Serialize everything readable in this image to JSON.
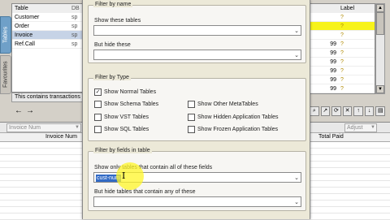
{
  "side_tabs": {
    "tables": "Tables",
    "favourites": "Favourites"
  },
  "table_list": {
    "header": {
      "name": "Table",
      "type": "DB"
    },
    "rows": [
      {
        "name": "Customer",
        "type": "sp"
      },
      {
        "name": "Order",
        "type": "sp"
      },
      {
        "name": "Invoice",
        "type": "sp"
      },
      {
        "name": "Ref.Call",
        "type": "sp"
      }
    ],
    "selected_index": 2,
    "description": "This contains transactions"
  },
  "right_grid": {
    "header": {
      "col_a": "",
      "label": "Label"
    },
    "rows": [
      {
        "a": "",
        "b": "?"
      },
      {
        "a": "",
        "b": "?"
      },
      {
        "a": "",
        "b": "?"
      },
      {
        "a": "99",
        "b": "?"
      },
      {
        "a": "99",
        "b": "?"
      },
      {
        "a": "99",
        "b": "?"
      },
      {
        "a": "99",
        "b": "?"
      },
      {
        "a": "99",
        "b": "?"
      },
      {
        "a": "99",
        "b": "?"
      }
    ],
    "highlight_color": "#f7f31a"
  },
  "bottom": {
    "filter_combo_left": "Invoice Num",
    "filter_combo_right": "Adjust",
    "columns": {
      "invoice_num": "Invoice Num",
      "total_paid": "Total Paid"
    }
  },
  "dialog": {
    "filter_by_name": {
      "title": "Filter by name",
      "show_label": "Show these tables",
      "show_value": "",
      "hide_label": "But hide these",
      "hide_value": ""
    },
    "filter_by_type": {
      "title": "Filter by Type",
      "options": {
        "normal": {
          "label": "Show Normal Tables",
          "checked": true
        },
        "schema": {
          "label": "Show Schema Tables",
          "checked": false
        },
        "vst": {
          "label": "Show VST Tables",
          "checked": false
        },
        "sql": {
          "label": "Show SQL Tables",
          "checked": false
        },
        "other_meta": {
          "label": "Show Other MetaTables",
          "checked": false
        },
        "hidden_app": {
          "label": "Show Hidden Application Tables",
          "checked": false
        },
        "frozen_app": {
          "label": "Show Frozen Application Tables",
          "checked": false
        }
      }
    },
    "filter_by_fields": {
      "title": "Filter by fields in table",
      "contain_all_label": "Show only tables that contain all of these fields",
      "contain_all_value": "cust-num",
      "contain_any_label": "But hide tables that contain any of these",
      "contain_any_value": ""
    }
  },
  "icons": {
    "nav_back": "arrow-left-icon",
    "nav_forward": "arrow-right-icon",
    "checkmark": "checkmark-icon",
    "dropdown": "chevron-down-icon"
  }
}
